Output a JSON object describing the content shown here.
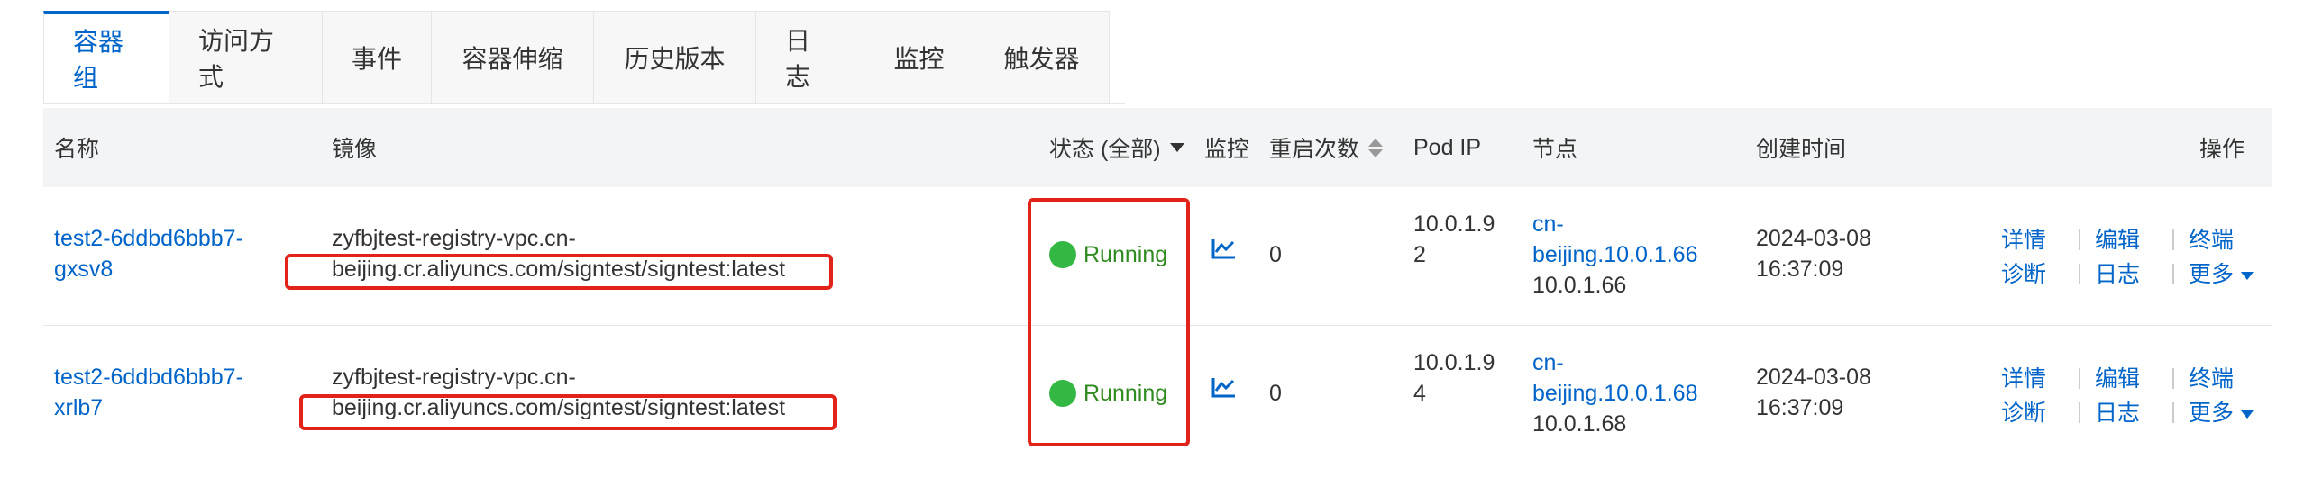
{
  "tabs": [
    {
      "label": "容器组",
      "active": true
    },
    {
      "label": "访问方式",
      "active": false
    },
    {
      "label": "事件",
      "active": false
    },
    {
      "label": "容器伸缩",
      "active": false
    },
    {
      "label": "历史版本",
      "active": false
    },
    {
      "label": "日志",
      "active": false
    },
    {
      "label": "监控",
      "active": false
    },
    {
      "label": "触发器",
      "active": false
    }
  ],
  "columns": {
    "name": "名称",
    "image": "镜像",
    "status": "状态 (全部)",
    "monitor": "监控",
    "restarts": "重启次数",
    "pod_ip": "Pod IP",
    "node": "节点",
    "created": "创建时间",
    "actions": "操作"
  },
  "rows": [
    {
      "name_line1": "test2-6ddbd6bbb7-",
      "name_line2": "gxsv8",
      "image_line1": "zyfbjtest-registry-vpc.cn-",
      "image_line2": "beijing.cr.aliyuncs.com/signtest/signtest:latest",
      "status": "Running",
      "restarts": "0",
      "pod_ip_line1": "10.0.1.9",
      "pod_ip_line2": "2",
      "node_line1": "cn-",
      "node_line2": "beijing.10.0.1.66",
      "node_ip": "10.0.1.66",
      "created_line1": "2024-03-08",
      "created_line2": "16:37:09"
    },
    {
      "name_line1": "test2-6ddbd6bbb7-",
      "name_line2": "xrlb7",
      "image_line1": "zyfbjtest-registry-vpc.cn-",
      "image_line2": "beijing.cr.aliyuncs.com/signtest/signtest:latest",
      "status": "Running",
      "restarts": "0",
      "pod_ip_line1": "10.0.1.9",
      "pod_ip_line2": "4",
      "node_line1": "cn-",
      "node_line2": "beijing.10.0.1.68",
      "node_ip": "10.0.1.68",
      "created_line1": "2024-03-08",
      "created_line2": "16:37:09"
    }
  ],
  "actions": {
    "details": "详情",
    "edit": "编辑",
    "terminal": "终端",
    "diagnose": "诊断",
    "logs": "日志",
    "more": "更多"
  },
  "icons": {
    "monitor": "line-chart-icon",
    "status_dot": "green-dot-icon",
    "sort": "sort-icon",
    "filter": "filter-caret-icon"
  },
  "colors": {
    "accent": "#0064c8",
    "running": "#33b843",
    "annotation": "#e2231a"
  }
}
